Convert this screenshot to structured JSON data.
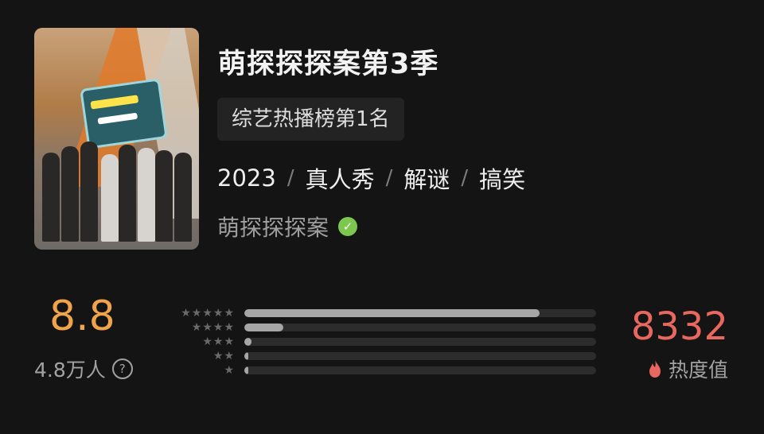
{
  "show": {
    "title": "萌探探探案第3季",
    "rank_badge": "综艺热播榜第1名",
    "year": "2023",
    "genres": [
      "真人秀",
      "解谜",
      "搞笑"
    ],
    "tag_separator": "/",
    "channel": "萌探探探案",
    "verified_icon": "check-badge-icon"
  },
  "rating": {
    "score": "8.8",
    "raters": "4.8万人",
    "help_icon": "question-circle-icon",
    "distribution": [
      {
        "stars": 5,
        "fraction": 0.84
      },
      {
        "stars": 4,
        "fraction": 0.11
      },
      {
        "stars": 3,
        "fraction": 0.02
      },
      {
        "stars": 2,
        "fraction": 0.01
      },
      {
        "stars": 1,
        "fraction": 0.01
      }
    ]
  },
  "heat": {
    "value": "8332",
    "label": "热度值",
    "icon": "flame-icon"
  },
  "colors": {
    "background": "#141414",
    "score": "#f0a34a",
    "heat": "#e8675e",
    "verified": "#7cc84e"
  }
}
